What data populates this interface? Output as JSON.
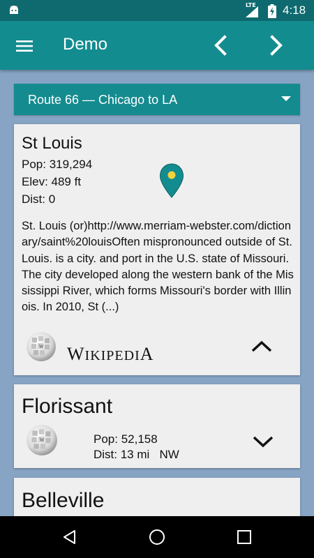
{
  "status_bar": {
    "time": "4:18",
    "network": "LTE",
    "icons": [
      "android-icon",
      "signal-icon",
      "battery-charging-icon"
    ]
  },
  "app_bar": {
    "title": "Demo",
    "icons": [
      "menu-icon",
      "chevron-left-icon",
      "chevron-right-icon"
    ]
  },
  "route_selector": {
    "selected": "Route 66 — Chicago to LA"
  },
  "cards": [
    {
      "name": "St Louis",
      "pop": "Pop: 319,294",
      "elev": "Elev: 489 ft",
      "dist": "Dist: 0",
      "description": "St. Louis (or)http://www.merriam-webster.com/dictionary/saint%20louisOften mispronounced outside of St. Louis. is a city. and port in the U.S. state of Missouri. The city developed along the western bank of the Mississippi River, which forms Missouri's border with Illinois. In 2010, St (...)",
      "source_wordmark": "Wikipedia",
      "expanded": true
    },
    {
      "name": "Florissant",
      "pop": "Pop: 52,158",
      "dist": "Dist: 13 mi   NW",
      "expanded": false
    },
    {
      "name": "Belleville"
    }
  ],
  "colors": {
    "status_bar": "#0e6a6f",
    "app_bar": "#138c90",
    "background": "#87a4c4",
    "card": "#efefef",
    "pin": "#138c90",
    "pin_dot": "#f3d33c"
  }
}
